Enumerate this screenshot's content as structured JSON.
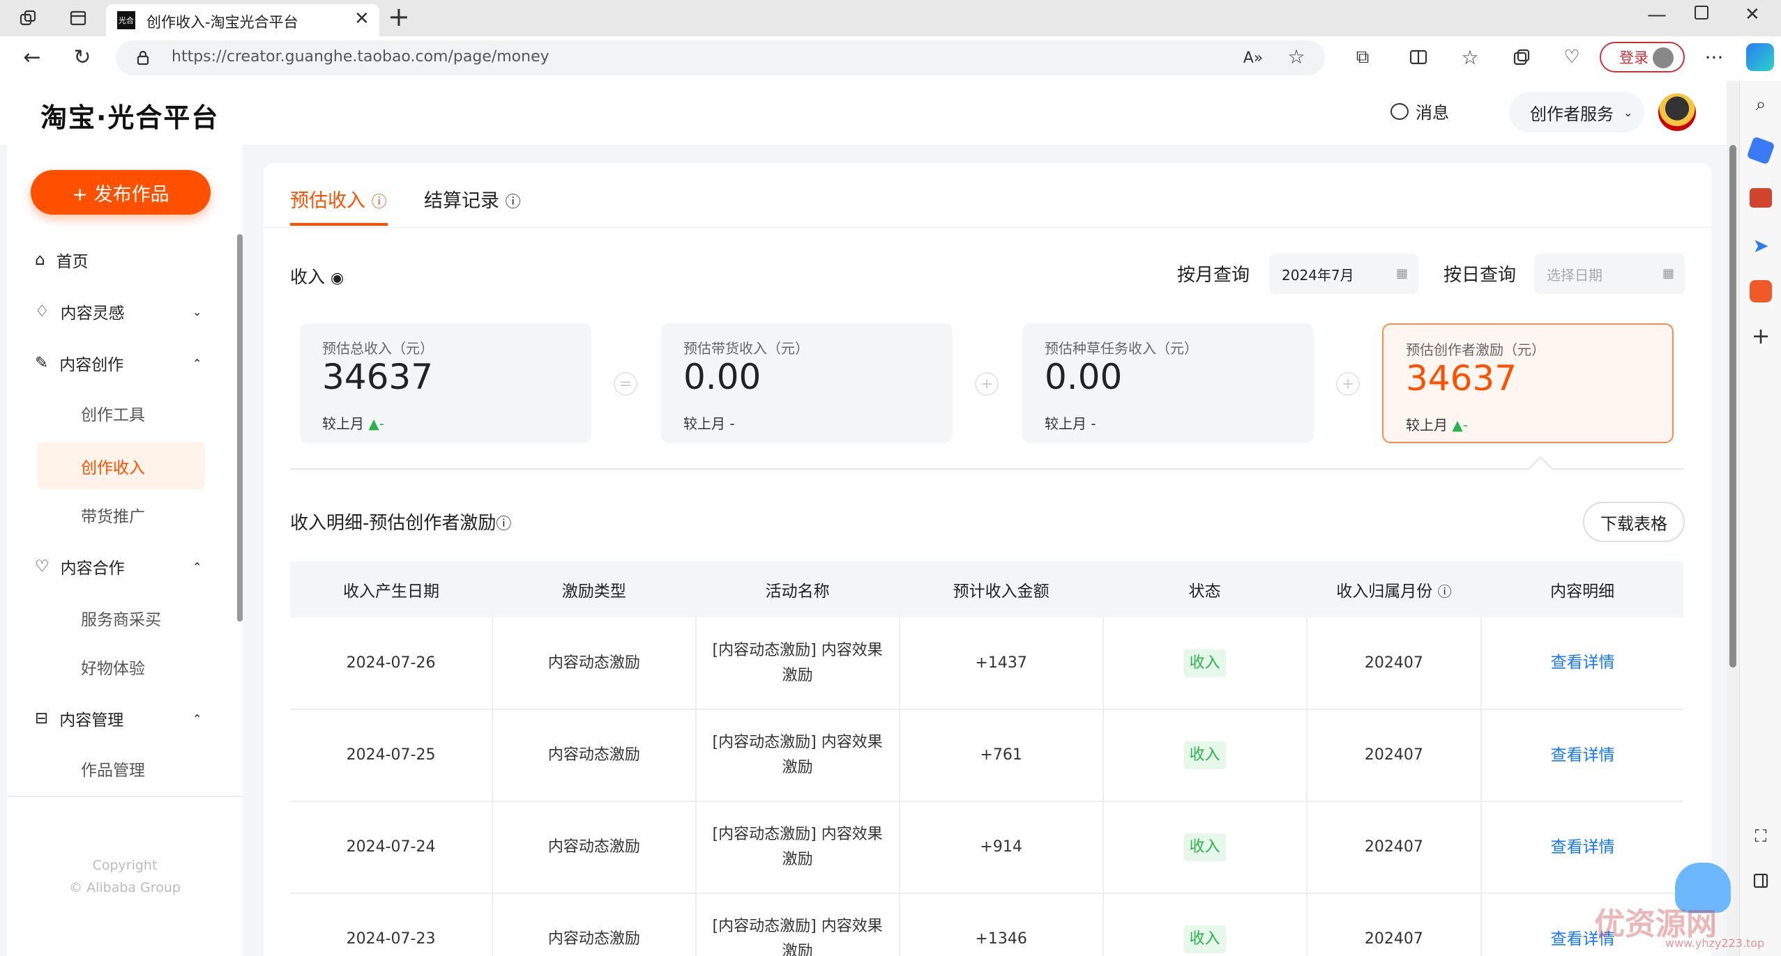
{
  "browser": {
    "tab_title": "创作收入-淘宝光合平台",
    "tab_favicon_text": "光合",
    "url": "https://creator.guanghe.taobao.com/page/money",
    "login_label": "登录"
  },
  "header": {
    "logo": "淘宝·光合平台",
    "messages": "消息",
    "service_menu": "创作者服务"
  },
  "sidebar": {
    "publish_button": "+ 发布作品",
    "items": [
      {
        "label": "首页"
      },
      {
        "label": "内容灵感"
      },
      {
        "label": "内容创作"
      },
      {
        "label": "创作工具"
      },
      {
        "label": "创作收入"
      },
      {
        "label": "带货推广"
      },
      {
        "label": "内容合作"
      },
      {
        "label": "服务商采买"
      },
      {
        "label": "好物体验"
      },
      {
        "label": "内容管理"
      },
      {
        "label": "作品管理"
      }
    ],
    "copyright_line1": "Copyright",
    "copyright_line2": "© Alibaba Group"
  },
  "tabs": {
    "estimated": "预估收入",
    "settlement": "结算记录"
  },
  "income": {
    "heading": "收入",
    "month_query_label": "按月查询",
    "month_value": "2024年7月",
    "day_query_label": "按日查询",
    "day_placeholder": "选择日期"
  },
  "kpis": [
    {
      "title": "预估总收入（元）",
      "value": "34637",
      "compare": "较上月",
      "trend": "▲-"
    },
    {
      "title": "预估带货收入（元）",
      "value": "0.00",
      "compare": "较上月",
      "trend": "-"
    },
    {
      "title": "预估种草任务收入（元）",
      "value": "0.00",
      "compare": "较上月",
      "trend": "-"
    },
    {
      "title": "预估创作者激励（元）",
      "value": "34637",
      "compare": "较上月",
      "trend": "▲-"
    }
  ],
  "operators": [
    "=",
    "+",
    "+"
  ],
  "detail": {
    "heading": "收入明细-预估创作者激励",
    "download": "下载表格",
    "columns": [
      "收入产生日期",
      "激励类型",
      "活动名称",
      "预计收入金额",
      "状态",
      "收入归属月份",
      "内容明细"
    ],
    "rows": [
      {
        "date": "2024-07-26",
        "type": "内容动态激励",
        "activity": "[内容动态激励] 内容效果激励",
        "amount": "+1437",
        "status": "收入",
        "month": "202407",
        "detail": "查看详情"
      },
      {
        "date": "2024-07-25",
        "type": "内容动态激励",
        "activity": "[内容动态激励] 内容效果激励",
        "amount": "+761",
        "status": "收入",
        "month": "202407",
        "detail": "查看详情"
      },
      {
        "date": "2024-07-24",
        "type": "内容动态激励",
        "activity": "[内容动态激励] 内容效果激励",
        "amount": "+914",
        "status": "收入",
        "month": "202407",
        "detail": "查看详情"
      },
      {
        "date": "2024-07-23",
        "type": "内容动态激励",
        "activity": "[内容动态激励] 内容效果激励",
        "amount": "+1346",
        "status": "收入",
        "month": "202407",
        "detail": "查看详情"
      }
    ]
  },
  "watermark": {
    "text": "优资源网",
    "url": "www.yhzy223.top"
  },
  "colors": {
    "brand": "#ff5000",
    "link": "#1677ff",
    "success": "#2bb24c"
  }
}
